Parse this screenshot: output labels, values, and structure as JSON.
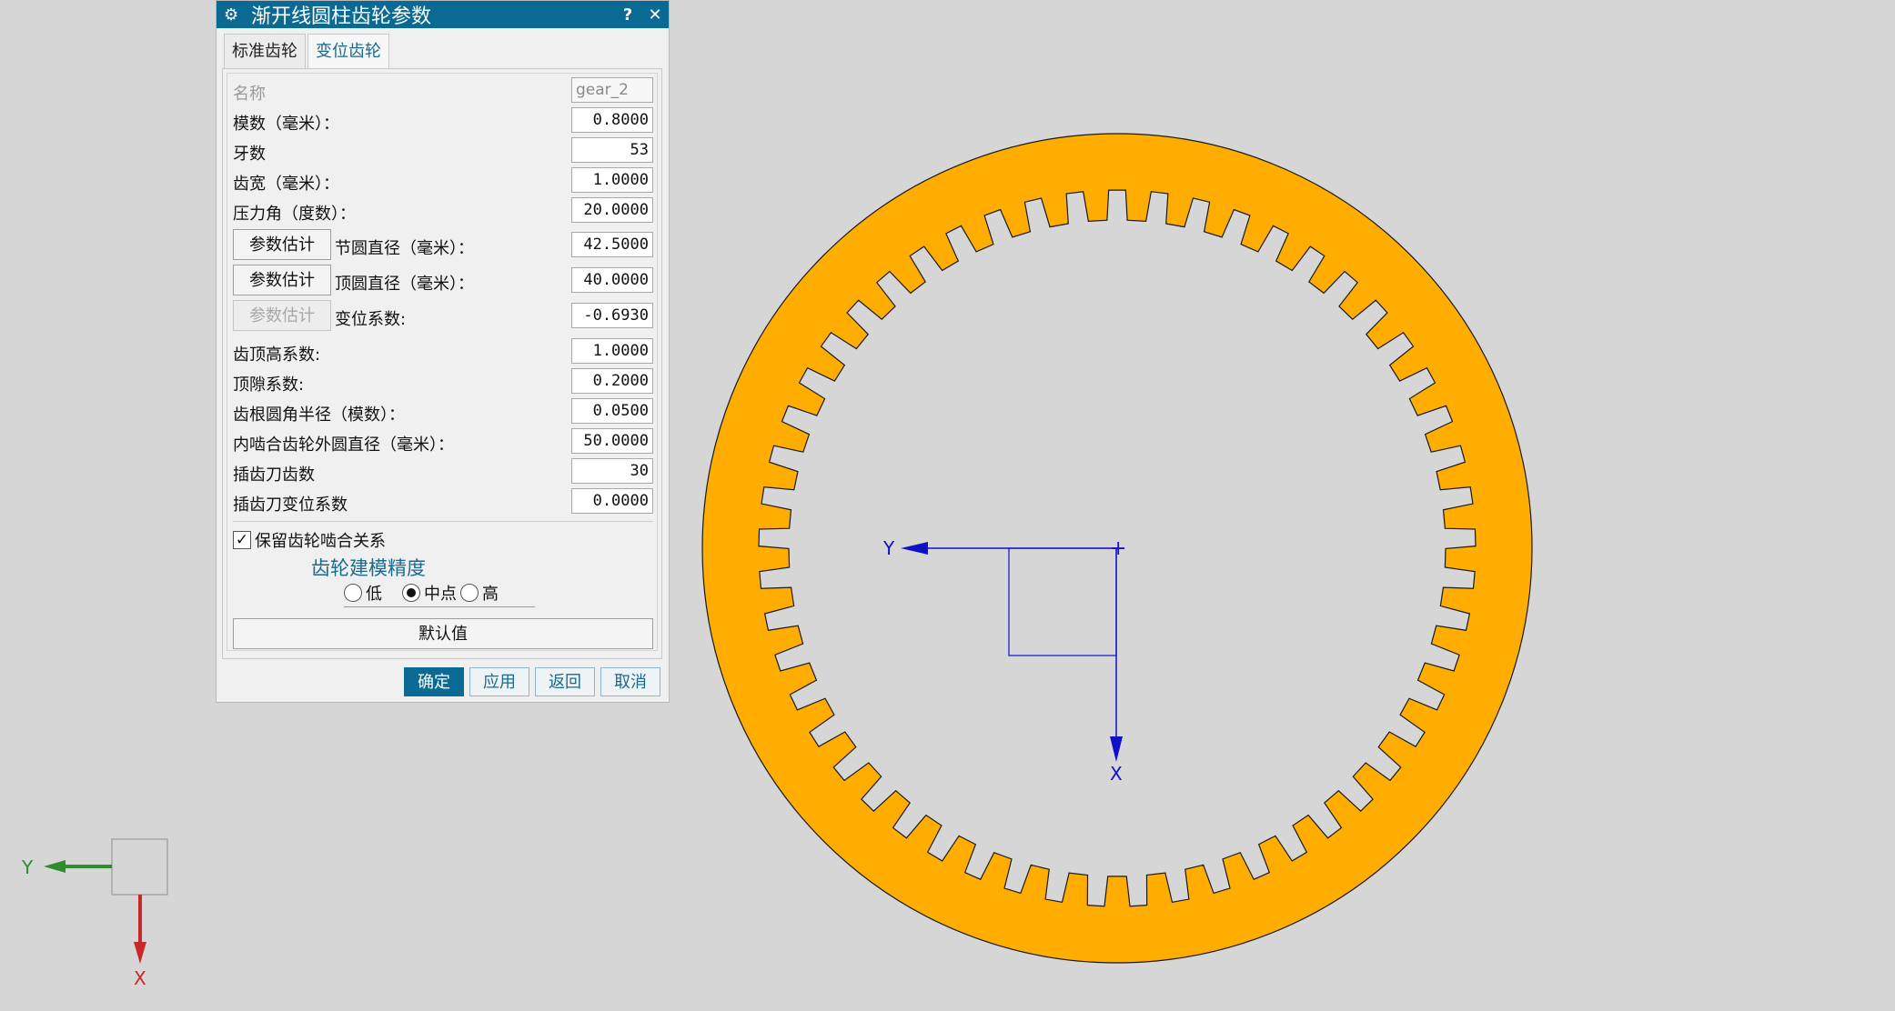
{
  "dialog": {
    "title": "渐开线圆柱齿轮参数",
    "help_icon": "?",
    "close_icon": "✕",
    "tabs": [
      {
        "label": "标准齿轮",
        "active": false
      },
      {
        "label": "变位齿轮",
        "active": true
      }
    ],
    "name_field": {
      "label": "名称",
      "value": "gear_2"
    },
    "module": {
      "label": "模数（毫米）：",
      "value": "0.8000"
    },
    "teeth": {
      "label": "牙数",
      "value": "53"
    },
    "face_width": {
      "label": "齿宽（毫米）：",
      "value": "1.0000"
    },
    "pressure_angle": {
      "label": "压力角（度数）：",
      "value": "20.0000"
    },
    "pitch_diameter": {
      "button": "参数估计",
      "label": "节圆直径（毫米）：",
      "value": "42.5000"
    },
    "tip_diameter": {
      "button": "参数估计",
      "label": "顶圆直径（毫米）：",
      "value": "40.0000"
    },
    "shift_coefficient": {
      "button": "参数估计",
      "label": "变位系数:",
      "value": "-0.6930"
    },
    "addendum_coefficient": {
      "label": "齿顶高系数:",
      "value": "1.0000"
    },
    "clearance_coefficient": {
      "label": "顶隙系数:",
      "value": "0.2000"
    },
    "root_fillet": {
      "label": "齿根圆角半径（模数）：",
      "value": "0.0500"
    },
    "internal_outer_diameter": {
      "label": "内啮合齿轮外圆直径（毫米）：",
      "value": "50.0000"
    },
    "cutter_teeth": {
      "label": "插齿刀齿数",
      "value": "30"
    },
    "cutter_shift": {
      "label": "插齿刀变位系数",
      "value": "0.0000"
    },
    "keep_mesh": {
      "label": "保留齿轮啮合关系",
      "checked": true,
      "mark": "✓"
    },
    "precision": {
      "title": "齿轮建模精度",
      "options": [
        {
          "label": "低",
          "selected": false
        },
        {
          "label": "中点",
          "selected": true
        },
        {
          "label": "高",
          "selected": false
        }
      ]
    },
    "default_button": "默认值",
    "footer": {
      "ok": "确定",
      "apply": "应用",
      "back": "返回",
      "cancel": "取消"
    }
  },
  "viewport": {
    "gear_color": "#ffad00",
    "gear_teeth": 53,
    "work_csys": {
      "y_label": "Y",
      "x_label": "X",
      "color": "#1010c8"
    },
    "view_triad": {
      "y_label": "Y",
      "x_label": "X",
      "y_color": "#2e8b2e",
      "x_color": "#c82828"
    }
  }
}
